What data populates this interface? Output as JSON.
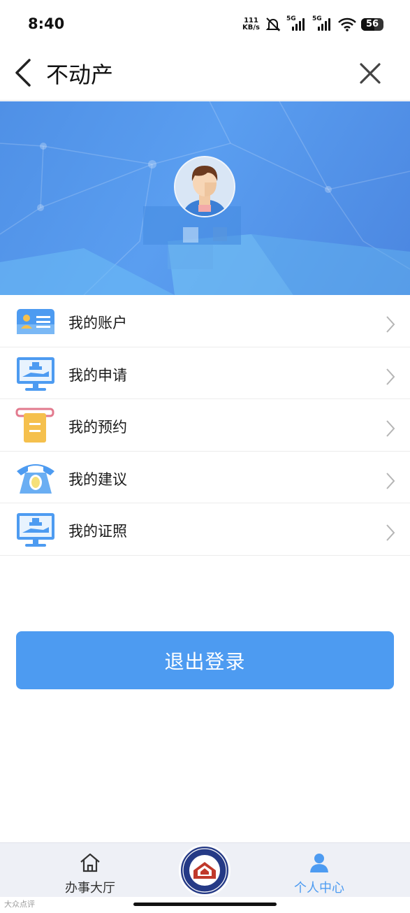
{
  "status": {
    "time": "8:40",
    "net_speed_value": "111",
    "net_speed_unit": "KB/s",
    "sim1": "5G",
    "sim2": "5G",
    "battery": "56"
  },
  "header": {
    "title": "不动产"
  },
  "menu": {
    "items": [
      {
        "label": "我的账户",
        "icon": "account-card-icon"
      },
      {
        "label": "我的申请",
        "icon": "application-monitor-icon"
      },
      {
        "label": "我的预约",
        "icon": "appointment-ticket-icon"
      },
      {
        "label": "我的建议",
        "icon": "telephone-icon"
      },
      {
        "label": "我的证照",
        "icon": "license-monitor-icon"
      }
    ]
  },
  "logout": {
    "label": "退出登录"
  },
  "tabs": {
    "hall": "办事大厅",
    "logo_top_text": "不动产登记",
    "logo_bottom_text": "Real Estate Registration",
    "profile": "个人中心"
  },
  "watermark": "大众点评",
  "colors": {
    "accent": "#4d9bf1",
    "banner": "#5a9ef0",
    "tab_active": "#4d9bf1",
    "tab_inactive": "#333333"
  }
}
